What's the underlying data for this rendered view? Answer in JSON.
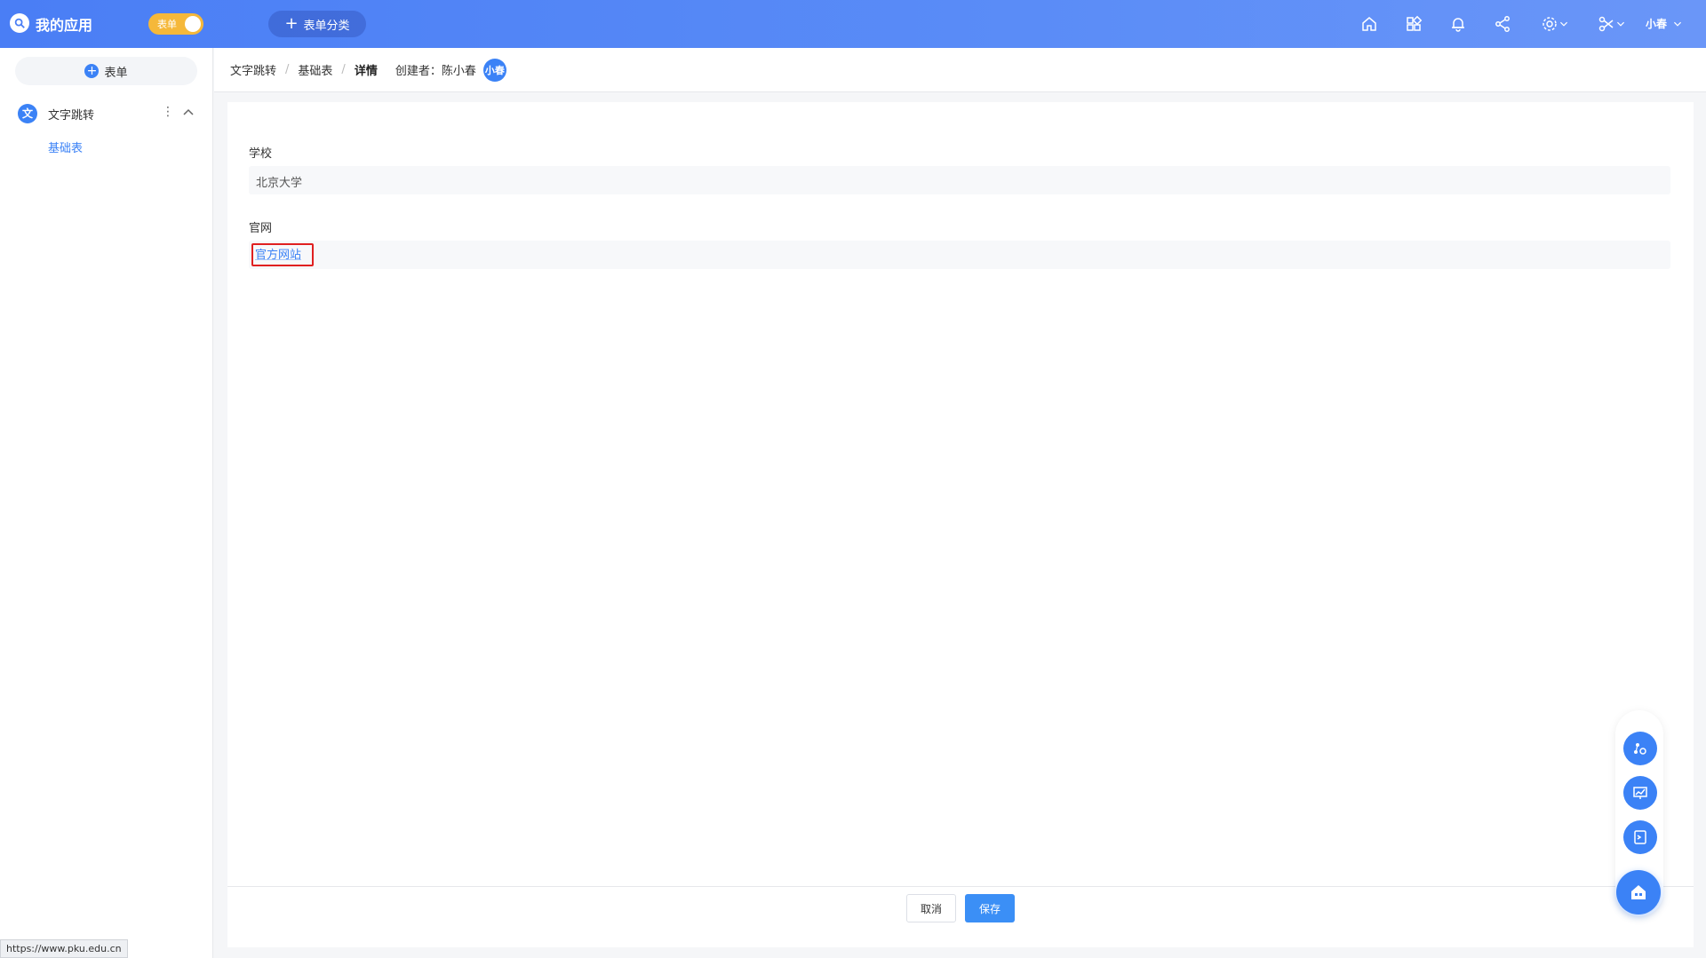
{
  "header": {
    "app_title": "我的应用",
    "toggle_label": "表单",
    "category_button": "表单分类",
    "user_name": "小春"
  },
  "sidebar": {
    "add_form_label": "表单",
    "group": {
      "icon_text": "文",
      "label": "文字跳转"
    },
    "sub_item": "基础表"
  },
  "breadcrumb": {
    "items": [
      "文字跳转",
      "基础表"
    ],
    "current": "详情",
    "creator_label": "创建者：陈小春",
    "avatar_text": "小春"
  },
  "form": {
    "fields": [
      {
        "label": "学校",
        "value": "北京大学"
      },
      {
        "label": "官网",
        "link_text": "官方网站"
      }
    ],
    "cancel_label": "取消",
    "save_label": "保存"
  },
  "status_bar": {
    "url": "https://www.pku.edu.cn"
  },
  "colors": {
    "primary": "#3b82f6",
    "header_start": "#4a7ef5",
    "toggle": "#f5b83a",
    "highlight": "#e02020"
  }
}
